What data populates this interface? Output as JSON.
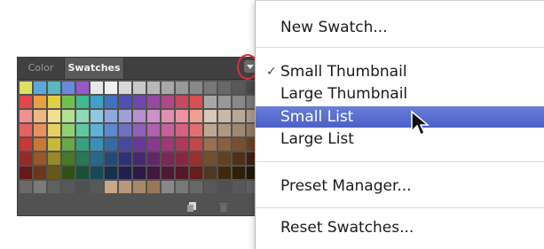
{
  "panel": {
    "tabs": [
      {
        "label": "Color",
        "active": false
      },
      {
        "label": "Swatches",
        "active": true
      }
    ],
    "menu_button_icon": "chevron-down-icon",
    "footer_icons": [
      "new-swatch-icon",
      "trash-icon"
    ]
  },
  "swatch_rows": [
    [
      "#e0e060",
      "#5aa8d8",
      "#58b8c0",
      "#6a8ad8",
      "#9858c8",
      "#e8e8e8",
      "#f0f0f0",
      "#d8d8d8",
      "#c8c8c8",
      "#b8b8b8",
      "#a8a8a8",
      "#989898",
      "#888888",
      "#787878",
      "#686868",
      "#585858",
      "#484848"
    ],
    [
      "#e04848",
      "#e8a040",
      "#e0d040",
      "#70c050",
      "#40b890",
      "#40a0c8",
      "#4070c0",
      "#5050b0",
      "#7048a8",
      "#9848a0",
      "#b04888",
      "#c84860",
      "#d85050",
      "#a8a8a8",
      "#989898",
      "#888888",
      "#787878"
    ],
    [
      "#f09090",
      "#f0b880",
      "#f0e090",
      "#b0e090",
      "#90d8b8",
      "#90c8e0",
      "#90a8e0",
      "#a0a0d8",
      "#b890d0",
      "#d090c8",
      "#e090b0",
      "#f090a0",
      "#f0a090",
      "#d8c8b8",
      "#c8b8a8",
      "#b8a898",
      "#a89888"
    ],
    [
      "#e86060",
      "#e89060",
      "#e8d060",
      "#90d070",
      "#60c8a0",
      "#60b0d8",
      "#6088d0",
      "#7070c0",
      "#9060b8",
      "#b060b0",
      "#c86098",
      "#d86080",
      "#e07070",
      "#c0a890",
      "#b09880",
      "#a08870",
      "#907860"
    ],
    [
      "#c83838",
      "#c87838",
      "#c8b838",
      "#68a848",
      "#38a080",
      "#3890b8",
      "#3868a8",
      "#4848a0",
      "#683898",
      "#883890",
      "#a03878",
      "#b03858",
      "#c04848",
      "#987050",
      "#886040",
      "#785030",
      "#684020"
    ],
    [
      "#982828",
      "#985828",
      "#988828",
      "#487828",
      "#287858",
      "#286888",
      "#284878",
      "#303078",
      "#482870",
      "#602868",
      "#782858",
      "#882840",
      "#983030",
      "#705030",
      "#604020",
      "#503018",
      "#402010"
    ],
    [
      "#681818",
      "#683818",
      "#685818",
      "#305018",
      "#185038",
      "#184858",
      "#183050",
      "#202050",
      "#301848",
      "#401840",
      "#501838",
      "#581828",
      "#681c1c",
      "#503820",
      "#402810",
      "#302008",
      "#201808"
    ],
    [
      "#6a6a6a",
      "#7a7a7a",
      "#606060",
      "#585858",
      "#505050",
      "#585858",
      "#c8a888",
      "#b89878",
      "#a88868",
      "#987858",
      "#888888",
      "#787878",
      "#686868",
      "#585858",
      "#505050",
      "#585858",
      "#606060"
    ]
  ],
  "menu": {
    "items": [
      {
        "label": "New Swatch...",
        "checked": false,
        "selected": false
      },
      {
        "label": "Small Thumbnail",
        "checked": true,
        "selected": false
      },
      {
        "label": "Large Thumbnail",
        "checked": false,
        "selected": false
      },
      {
        "label": "Small List",
        "checked": false,
        "selected": true
      },
      {
        "label": "Large List",
        "checked": false,
        "selected": false
      },
      {
        "label": "Preset Manager...",
        "checked": false,
        "selected": false
      },
      {
        "label": "Reset Swatches...",
        "checked": false,
        "selected": false
      }
    ],
    "check_glyph": "✓",
    "selected_color": "#5468cc"
  }
}
